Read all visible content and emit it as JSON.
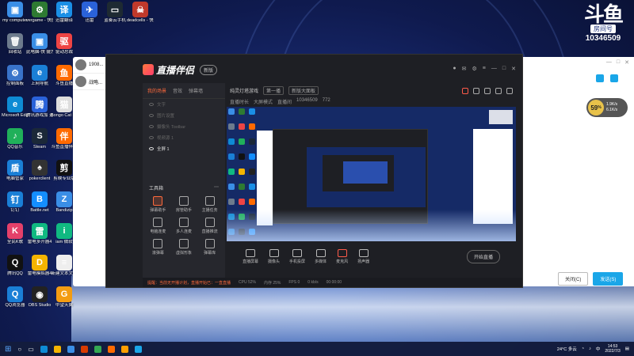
{
  "desktop": {
    "icons": [
      {
        "label": "my\ncomputer",
        "color": "#3a8ee6",
        "glyph": "▣"
      },
      {
        "label": "vergame -\n快捷方式",
        "color": "#2e7a32",
        "glyph": "⚙"
      },
      {
        "label": "迅雷翻译",
        "color": "#1a8fe6",
        "glyph": "译"
      },
      {
        "label": "回收站",
        "color": "#6d7b8d",
        "glyph": "🗑"
      },
      {
        "label": "此电脑-快\n捷方式",
        "color": "#3a8ee6",
        "glyph": "▣"
      },
      {
        "label": "驱动总裁",
        "color": "#e44",
        "glyph": "驱"
      },
      {
        "label": "控制面板",
        "color": "#3973c9",
        "glyph": "⚙"
      },
      {
        "label": "上网导航",
        "color": "#1a7fd6",
        "glyph": "e"
      },
      {
        "label": "斗鱼直播",
        "color": "#ff6a00",
        "glyph": "鱼"
      },
      {
        "label": "Microsoft\nEdge",
        "color": "#0e8bd4",
        "glyph": "e"
      },
      {
        "label": "腾讯游戏加\n速器",
        "color": "#2a62d9",
        "glyph": "腾"
      },
      {
        "label": "Bongo Cat\nMver - 快捷\n方式",
        "color": "#ddd",
        "glyph": "猫"
      },
      {
        "label": "QQ音乐",
        "color": "#20b05a",
        "glyph": "♪"
      },
      {
        "label": "Steam",
        "color": "#1b2838",
        "glyph": "S"
      },
      {
        "label": "斗鱼直播伴侣",
        "color": "#ff6a00",
        "glyph": "伴"
      },
      {
        "label": "电脑管家",
        "color": "#1a7fd6",
        "glyph": "盾"
      },
      {
        "label": "pokerclient",
        "color": "#333",
        "glyph": "♠"
      },
      {
        "label": "剪映专业版",
        "color": "#111",
        "glyph": "剪"
      },
      {
        "label": "钉钉",
        "color": "#1a7fd6",
        "glyph": "钉"
      },
      {
        "label": "Battle.net",
        "color": "#148eff",
        "glyph": "B"
      },
      {
        "label": "Bandizip",
        "color": "#3a8ee6",
        "glyph": "Z"
      },
      {
        "label": "全民K歌",
        "color": "#e4406a",
        "glyph": "K"
      },
      {
        "label": "雷电多开器4",
        "color": "#10b981",
        "glyph": "雷"
      },
      {
        "label": "iam\n微软",
        "color": "#10b981",
        "glyph": "i"
      },
      {
        "label": "腾讯QQ",
        "color": "#111",
        "glyph": "Q"
      },
      {
        "label": "雷电模拟器4",
        "color": "#f4b400",
        "glyph": "D"
      },
      {
        "label": "新建文本文档",
        "color": "#eee",
        "glyph": "≡"
      },
      {
        "label": "QQ浏览器",
        "color": "#1a7fd6",
        "glyph": "Q"
      },
      {
        "label": "OBS Studio",
        "color": "#222",
        "glyph": "◉"
      },
      {
        "label": "中望天翼",
        "color": "#f39c12",
        "glyph": "G"
      }
    ],
    "top_extra_icons": [
      {
        "label": "迅雷",
        "color": "#2a62d9",
        "glyph": "✈"
      },
      {
        "label": "蓝奏云手机",
        "color": "#1e2a32",
        "glyph": "▭"
      },
      {
        "label": "deadcells -\n快捷方式",
        "color": "#c0392b",
        "glyph": "☠"
      }
    ]
  },
  "brand": {
    "mark": "斗鱼",
    "sub": "房间号",
    "room": "10346509"
  },
  "chat_window": {
    "rows": [
      {
        "name": "1908..."
      },
      {
        "name": "战略..."
      }
    ]
  },
  "right_window": {
    "gauge_value": "59",
    "gauge_unit": "%",
    "gauge_sub1": "1.9K/s",
    "gauge_sub2": "6.1K/s",
    "close_button": "关闭(C)",
    "send_button": "发送(S)"
  },
  "app": {
    "title": "直播伴侣",
    "version": "新版",
    "left_tabs": [
      "我的场景",
      "音效",
      "弹幕墙"
    ],
    "scene_items": [
      {
        "label": "文字",
        "on": false
      },
      {
        "label": "图片设置",
        "on": false
      },
      {
        "label": "摄像头 Toolbar",
        "on": false
      },
      {
        "label": "视频源 1",
        "on": false
      },
      {
        "label": "全屏 1",
        "on": true
      }
    ],
    "tools_title": "工具箱",
    "tools": [
      {
        "label": "弹幕助手",
        "hot": true
      },
      {
        "label": "房管助手",
        "hot": false
      },
      {
        "label": "主播任务",
        "hot": false
      },
      {
        "label": "电脑连麦",
        "hot": false
      },
      {
        "label": "多人连麦",
        "hot": false
      },
      {
        "label": "直播推流",
        "hot": false
      },
      {
        "label": "滚弹幕",
        "hot": false
      },
      {
        "label": "虚拟形象",
        "hot": false
      },
      {
        "label": "弹幕库",
        "hot": false
      }
    ],
    "center": {
      "stream_title": "纯灵灯塔游戏",
      "pill1": "第一播",
      "pill2": "新版大面板",
      "tag1": "直播时长",
      "tag2": "大屏模式",
      "tag3": "直播间",
      "tag4": "10346509",
      "viewers": "772"
    },
    "bottom_buttons": [
      "直播屏幕",
      "摄像头",
      "手机投屏",
      "多媒体",
      "麦克风",
      "扬声器"
    ],
    "start_button": "开始直播",
    "status": {
      "warn": "提醒：当前无开播计划，直播开始已：一直直播",
      "cpu": "CPU 52%",
      "mem": "内存 25%",
      "fps": "FPS 0",
      "bitrate": "0 kb/s",
      "time": "00:00:00"
    }
  },
  "taskbar": {
    "weather": "24°C 多云",
    "lang": "中",
    "time": "14:53",
    "date": "2022/7/3"
  }
}
